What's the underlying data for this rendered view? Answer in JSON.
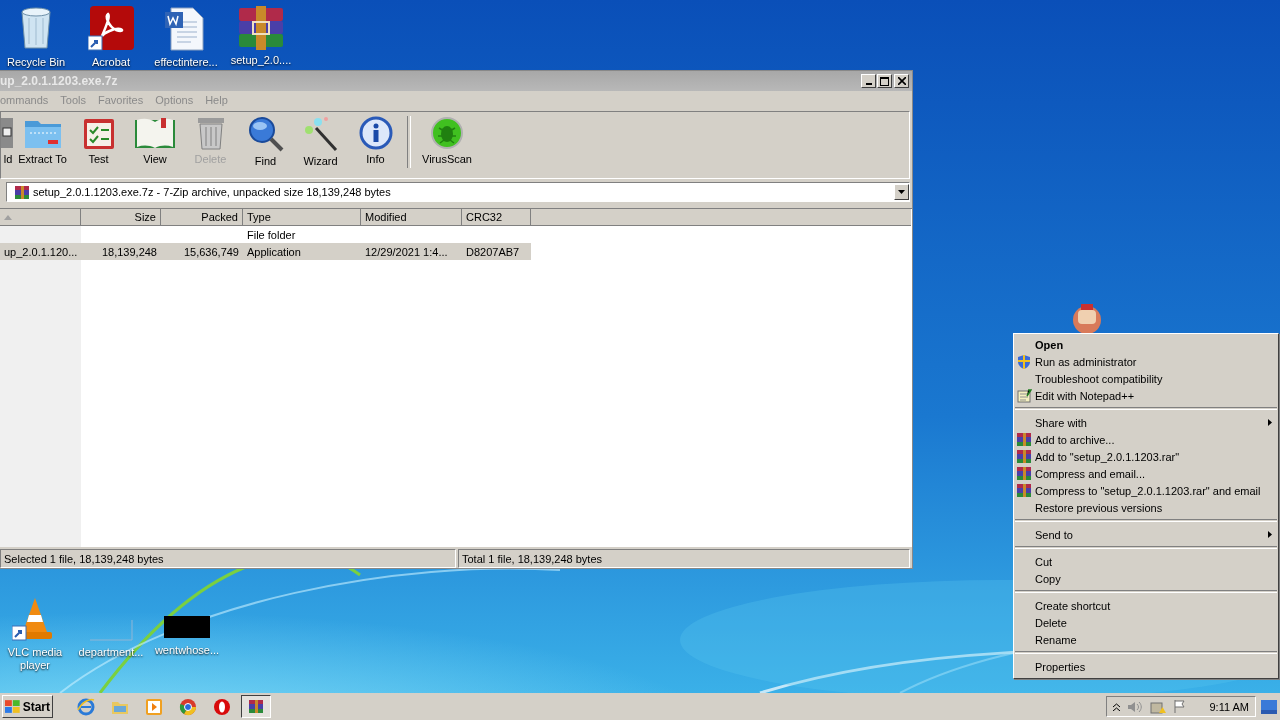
{
  "desktop_icons": [
    {
      "label": "Recycle Bin",
      "kind": "recycle",
      "shortcut": false
    },
    {
      "label": "Acrobat",
      "kind": "acrobat",
      "shortcut": true
    },
    {
      "label": "effectintere...",
      "kind": "word",
      "shortcut": false
    },
    {
      "label": "setup_2.0....",
      "kind": "archive",
      "shortcut": false
    }
  ],
  "desktop_icons_bottom": [
    {
      "label": "VLC media player",
      "kind": "vlc",
      "shortcut": true
    },
    {
      "label": "department...",
      "kind": "blank",
      "shortcut": false
    },
    {
      "label": "wentwhose...",
      "kind": "dark",
      "shortcut": false
    }
  ],
  "window": {
    "title": "up_2.0.1.1203.exe.7z",
    "menu": [
      "ommands",
      "Tools",
      "Favorites",
      "Options",
      "Help"
    ],
    "toolbar": [
      {
        "label": "ld",
        "kind": "partial",
        "disabled": false
      },
      {
        "label": "Extract To",
        "kind": "folder",
        "disabled": false
      },
      {
        "label": "Test",
        "kind": "test",
        "disabled": false
      },
      {
        "label": "View",
        "kind": "book",
        "disabled": false
      },
      {
        "label": "Delete",
        "kind": "trash",
        "disabled": true
      },
      {
        "label": "Find",
        "kind": "find",
        "disabled": false
      },
      {
        "label": "Wizard",
        "kind": "wand",
        "disabled": false
      },
      {
        "label": "Info",
        "kind": "info",
        "disabled": false
      },
      {
        "kind": "separator"
      },
      {
        "label": "VirusScan",
        "kind": "scan",
        "disabled": false
      }
    ],
    "address": "setup_2.0.1.1203.exe.7z - 7-Zip archive, unpacked size 18,139,248 bytes",
    "columns": [
      "Size",
      "Packed",
      "Type",
      "Modified",
      "CRC32"
    ],
    "rows": [
      {
        "type": "File folder",
        "selected": false
      },
      {
        "name": "up_2.0.1.120...",
        "size": "18,139,248",
        "packed": "15,636,749",
        "type": "Application",
        "modified": "12/29/2021 1:4...",
        "crc": "D8207AB7",
        "selected": true
      }
    ],
    "status": [
      "Selected 1 file, 18,139,248 bytes",
      "Total 1 file, 18,139,248 bytes"
    ]
  },
  "context_menu": [
    {
      "kind": "plain",
      "label": "Open",
      "default": true,
      "submenu": false
    },
    {
      "kind": "shield",
      "label": "Run as administrator",
      "default": false,
      "submenu": false
    },
    {
      "kind": "plain",
      "label": "Troubleshoot compatibility",
      "default": false,
      "submenu": false
    },
    {
      "kind": "notepad",
      "label": "Edit with Notepad++",
      "default": false,
      "submenu": false
    },
    {
      "kind": "separator"
    },
    {
      "kind": "plain",
      "label": "Share with",
      "default": false,
      "submenu": true
    },
    {
      "kind": "archive",
      "label": "Add to archive...",
      "default": false,
      "submenu": false
    },
    {
      "kind": "archive",
      "label": "Add to \"setup_2.0.1.1203.rar\"",
      "default": false,
      "submenu": false
    },
    {
      "kind": "archive",
      "label": "Compress and email...",
      "default": false,
      "submenu": false
    },
    {
      "kind": "archive",
      "label": "Compress to \"setup_2.0.1.1203.rar\" and email",
      "default": false,
      "submenu": false
    },
    {
      "kind": "plain",
      "label": "Restore previous versions",
      "default": false,
      "submenu": false
    },
    {
      "kind": "separator"
    },
    {
      "kind": "plain",
      "label": "Send to",
      "default": false,
      "submenu": true
    },
    {
      "kind": "separator"
    },
    {
      "kind": "plain",
      "label": "Cut",
      "default": false,
      "submenu": false
    },
    {
      "kind": "plain",
      "label": "Copy",
      "default": false,
      "submenu": false
    },
    {
      "kind": "separator"
    },
    {
      "kind": "plain",
      "label": "Create shortcut",
      "default": false,
      "submenu": false
    },
    {
      "kind": "plain",
      "label": "Delete",
      "default": false,
      "submenu": false
    },
    {
      "kind": "plain",
      "label": "Rename",
      "default": false,
      "submenu": false
    },
    {
      "kind": "separator"
    },
    {
      "kind": "plain",
      "label": "Properties",
      "default": false,
      "submenu": false
    }
  ],
  "taskbar": {
    "start": "Start",
    "apps": [
      {
        "kind": "ie",
        "selected": false
      },
      {
        "kind": "explorer",
        "selected": false
      },
      {
        "kind": "media",
        "selected": false
      },
      {
        "kind": "chrome",
        "selected": false
      },
      {
        "kind": "opera",
        "selected": false
      },
      {
        "kind": "archive",
        "selected": true
      }
    ],
    "clock": "9:11 AM"
  }
}
